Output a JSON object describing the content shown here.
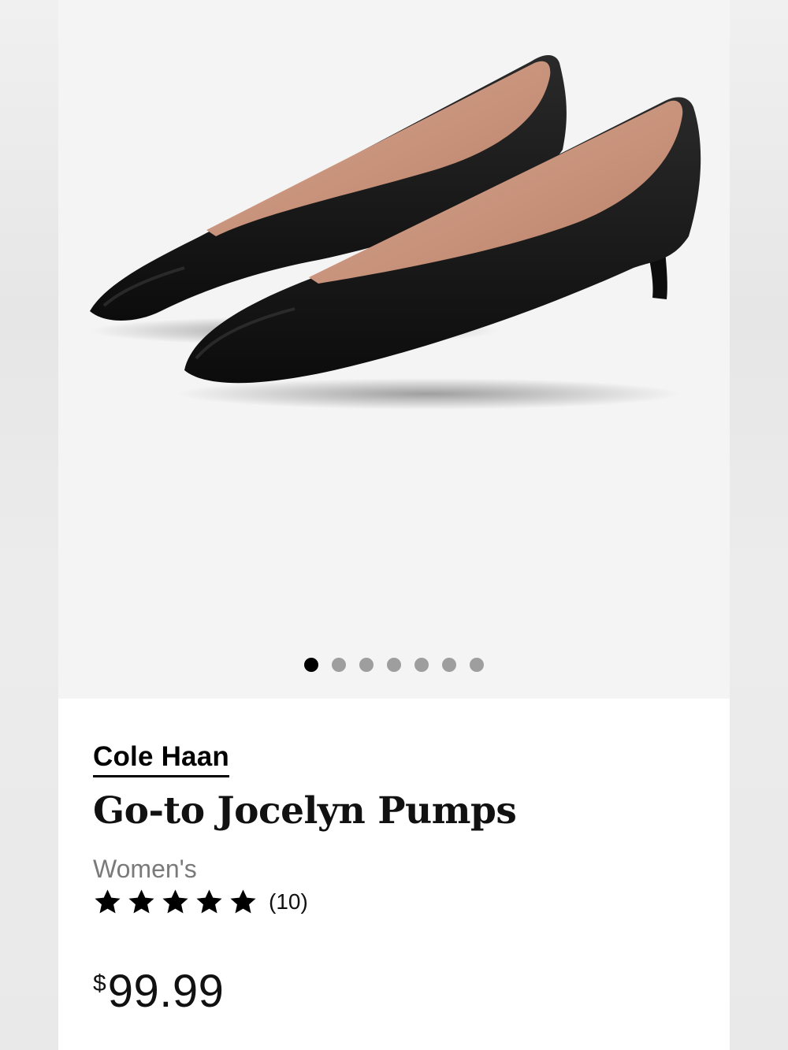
{
  "product": {
    "brand": "Cole Haan",
    "title": "Go-to Jocelyn Pumps",
    "gender": "Women's",
    "rating": 5,
    "rating_max": 5,
    "review_count": "(10)",
    "price_currency": "$",
    "price_amount": "99.99"
  },
  "gallery": {
    "image_count": 7,
    "active_index": 0
  },
  "colors": {
    "image_background": "#f4f4f4",
    "dot_active": "#000000",
    "dot_inactive": "#9e9e9e",
    "shoe_leather": "#141414",
    "shoe_lining": "#c8907a"
  }
}
